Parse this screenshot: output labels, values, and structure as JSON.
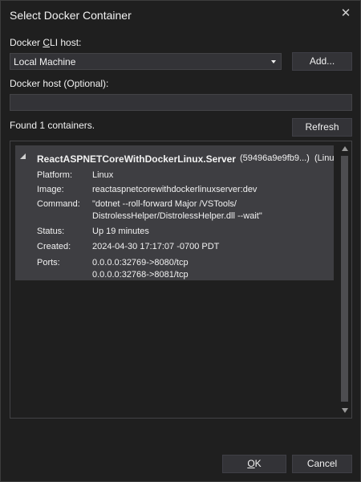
{
  "window": {
    "title": "Select Docker Container",
    "close_glyph": "✕"
  },
  "cli_host": {
    "label_pre": "Docker ",
    "label_access": "C",
    "label_post": "LI host:",
    "value": "Local Machine",
    "add_label": "Add..."
  },
  "docker_host": {
    "label": "Docker host (Optional):",
    "value": ""
  },
  "found": {
    "text": "Found 1 containers.",
    "refresh_label": "Refresh"
  },
  "container": {
    "name": "ReactASPNETCoreWithDockerLinux.Server",
    "id": "(59496a9e9fb9...)",
    "os_short": "(Linu",
    "props": [
      {
        "key": "Platform:",
        "lines": [
          "Linux"
        ]
      },
      {
        "key": "Image:",
        "lines": [
          "reactaspnetcorewithdockerlinuxserver:dev"
        ]
      },
      {
        "key": "Command:",
        "lines": [
          "\"dotnet --roll-forward Major /VSTools/",
          "DistrolessHelper/DistrolessHelper.dll --wait\""
        ]
      },
      {
        "key": "Status:",
        "lines": [
          "Up 19 minutes"
        ]
      },
      {
        "key": "Created:",
        "lines": [
          "2024-04-30 17:17:07 -0700 PDT"
        ]
      },
      {
        "key": "Ports:",
        "lines": [
          "0.0.0.0:32769->8080/tcp",
          "0.0.0.0:32768->8081/tcp"
        ]
      }
    ]
  },
  "footer": {
    "ok_access": "O",
    "ok_rest": "K",
    "cancel_label": "Cancel"
  },
  "colors": {
    "background": "#1f1f1f",
    "item_bg": "#3e3e42",
    "control_bg": "#333337",
    "border": "#434346"
  }
}
